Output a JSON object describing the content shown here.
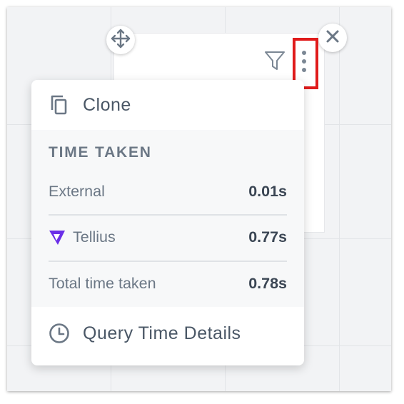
{
  "menu": {
    "clone_label": "Clone",
    "time_taken": {
      "title": "TIME TAKEN",
      "rows": [
        {
          "label": "External",
          "value": "0.01s"
        },
        {
          "label": "Tellius",
          "value": "0.77s"
        },
        {
          "label": "Total time taken",
          "value": "0.78s"
        }
      ]
    },
    "query_details_label": "Query Time Details"
  },
  "icons": {
    "move": "move-icon",
    "close": "close-icon",
    "filter": "filter-icon",
    "more": "more-vertical-icon",
    "clone": "copy-icon",
    "tellius": "tellius-logo-icon",
    "clock": "clock-icon"
  },
  "colors": {
    "highlight": "#e01b1b",
    "tellius_brand": "#6a2ee8",
    "text_muted": "#6b7785",
    "text_strong": "#3b4654"
  }
}
